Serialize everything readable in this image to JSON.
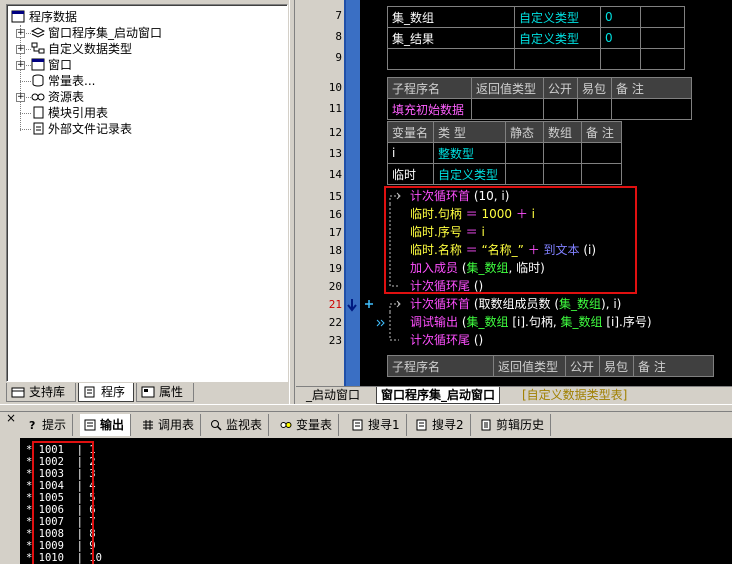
{
  "tree": {
    "root": "程序数据",
    "items": [
      {
        "label": "窗口程序集_启动窗口",
        "expander": "+"
      },
      {
        "label": "自定义数据类型",
        "expander": "+"
      },
      {
        "label": "窗口",
        "expander": "+"
      },
      {
        "label": "常量表...",
        "expander": ""
      },
      {
        "label": "资源表",
        "expander": "+"
      },
      {
        "label": "模块引用表",
        "expander": ""
      },
      {
        "label": "外部文件记录表",
        "expander": ""
      }
    ],
    "tabs": [
      "支持库",
      "程序",
      "属性"
    ]
  },
  "editor": {
    "line_numbers": [
      "7",
      "8",
      "9",
      "10",
      "11",
      "12",
      "13",
      "14",
      "15",
      "16",
      "17",
      "18",
      "19",
      "20",
      "21",
      "22",
      "23"
    ],
    "vars_top": [
      {
        "name": "集_数组",
        "type": "自定义类型",
        "val": "0"
      },
      {
        "name": "集_结果",
        "type": "自定义类型",
        "val": "0"
      }
    ],
    "sub_header": [
      "子程序名",
      "返回值类型",
      "公开",
      "易包",
      "备 注"
    ],
    "sub_name": "填充初始数据",
    "var_header": [
      "变量名",
      "类 型",
      "静态",
      "数组",
      "备 注"
    ],
    "locals": [
      {
        "name": "i",
        "type": "整数型"
      },
      {
        "name": "临时",
        "type": "自定义类型"
      }
    ],
    "code": {
      "l15_kw": "计次循环首",
      "l15_args": " (10, i)",
      "l16_a": "临时.句柄",
      "l16_eq": " ＝ ",
      "l16_b": "1000",
      "l16_plus": " ＋ ",
      "l16_c": "i",
      "l17_a": "临时.序号",
      "l17_eq": " ＝ ",
      "l17_c": "i",
      "l18_a": "临时.名称",
      "l18_eq": " ＝ ",
      "l18_s": "“名称_”",
      "l18_plus": " ＋ ",
      "l18_f": "到文本",
      "l18_args": " (i)",
      "l19_f": "加入成员",
      "l19_args1": " (",
      "l19_v": "集_数组",
      "l19_args2": ", 临时)",
      "l20_kw": "计次循环尾",
      "l20_args": " ()",
      "l21_kw": "计次循环首",
      "l21_args1": " (取数组成员数 (",
      "l21_v": "集_数组",
      "l21_args2": "), i)",
      "l22_f": "调试输出",
      "l22_a1": " (",
      "l22_v1": "集_数组",
      "l22_a2": " [i].句柄, ",
      "l22_v2": "集_数组",
      "l22_a3": " [i].序号)",
      "l23_kw": "计次循环尾",
      "l23_args": " ()"
    },
    "bottom_header": [
      "子程序名",
      "返回值类型",
      "公开",
      "易包",
      "备 注"
    ],
    "tabs": [
      "_启动窗口",
      "窗口程序集_启动窗口",
      "[自定义数据类型表]"
    ]
  },
  "bottom_tabs": [
    "提示",
    "输出",
    "调用表",
    "监视表",
    "变量表",
    "搜寻1",
    "搜寻2",
    "剪辑历史"
  ],
  "output": {
    "rows": [
      {
        "a": "1001",
        "b": "1"
      },
      {
        "a": "1002",
        "b": "2"
      },
      {
        "a": "1003",
        "b": "3"
      },
      {
        "a": "1004",
        "b": "4"
      },
      {
        "a": "1005",
        "b": "5"
      },
      {
        "a": "1006",
        "b": "6"
      },
      {
        "a": "1007",
        "b": "7"
      },
      {
        "a": "1008",
        "b": "8"
      },
      {
        "a": "1009",
        "b": "9"
      },
      {
        "a": "1010",
        "b": "10"
      }
    ]
  },
  "colors": {
    "highlight_box": "#e01010",
    "editor_bg": "#000000",
    "blue_bar": "#3a6fc4"
  }
}
